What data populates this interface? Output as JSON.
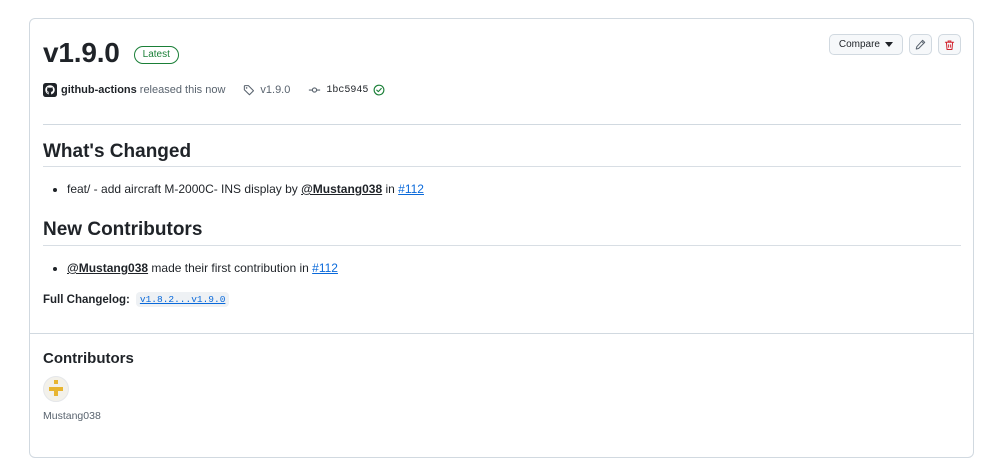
{
  "release": {
    "title": "v1.9.0",
    "badge": "Latest",
    "author": "github-actions",
    "released_text": "released this now",
    "tag": "v1.9.0",
    "commit": "1bc5945"
  },
  "actions": {
    "compare_label": "Compare"
  },
  "body": {
    "whats_changed_heading": "What's Changed",
    "change_item": {
      "text": "feat/ - add aircraft M-2000C- INS display by ",
      "user": "@Mustang038",
      "in_text": " in ",
      "pr": "#112"
    },
    "new_contributors_heading": "New Contributors",
    "contributor_item": {
      "user": "@Mustang038",
      "text": " made their first contribution in ",
      "pr": "#112"
    },
    "changelog_label": "Full Changelog:",
    "changelog_link": "v1.8.2...v1.9.0"
  },
  "contributors": {
    "heading": "Contributors",
    "names": [
      "Mustang038"
    ]
  },
  "colors": {
    "accent": "#0969da",
    "success": "#1a7f37",
    "danger": "#d1242f",
    "border": "#d1d9e0"
  },
  "icons": {
    "author_avatar": "github-logo-icon",
    "tag": "tag-icon",
    "commit": "git-commit-icon",
    "verified": "check-circle-icon",
    "edit": "pencil-icon",
    "delete": "trash-icon",
    "dropdown": "triangle-down-icon"
  }
}
